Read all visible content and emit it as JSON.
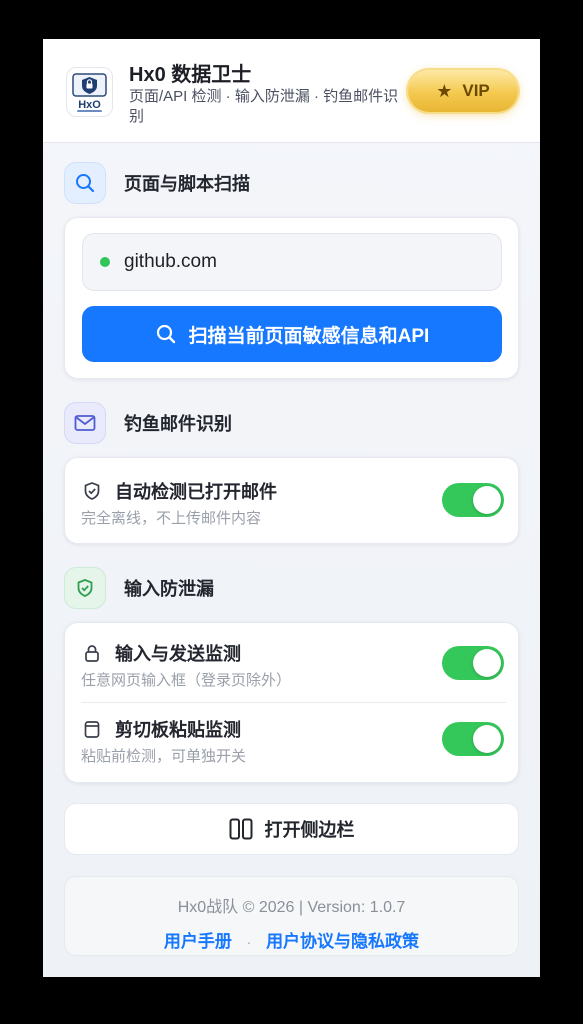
{
  "header": {
    "title": "Hx0 数据卫士",
    "subtitle": "页面/API 检测 · 输入防泄漏 · 钓鱼邮件识别",
    "logo_text": "HxO",
    "vip_label": "VIP",
    "vip_icon": "star-icon"
  },
  "scan_section": {
    "title": "页面与脚本扫描",
    "icon": "search-icon",
    "url": "github.com",
    "status_color": "#2fc55a",
    "button_label": "扫描当前页面敏感信息和API"
  },
  "phishing_section": {
    "title": "钓鱼邮件识别",
    "icon": "mail-icon",
    "items": [
      {
        "title": "自动检测已打开邮件",
        "desc": "完全离线，不上传邮件内容",
        "icon": "shield-icon",
        "enabled": true
      }
    ]
  },
  "leak_section": {
    "title": "输入防泄漏",
    "icon": "shield-check-icon",
    "items": [
      {
        "title": "输入与发送监测",
        "desc": "任意网页输入框（登录页除外）",
        "icon": "lock-icon",
        "enabled": true
      },
      {
        "title": "剪切板粘贴监测",
        "desc": "粘贴前检测，可单独开关",
        "icon": "clipboard-icon",
        "enabled": true
      }
    ]
  },
  "sidebar_button": {
    "label": "打开侧边栏",
    "icon": "sidebar-icon"
  },
  "footer": {
    "version_text": "Hx0战队 © 2026 | Version: 1.0.7",
    "links": [
      "用户手册",
      "用户协议与隐私政策"
    ],
    "separator": "·"
  },
  "colors": {
    "accent": "#1677ff",
    "toggle_on": "#34c759",
    "vip_gold": "#f4c94f"
  }
}
